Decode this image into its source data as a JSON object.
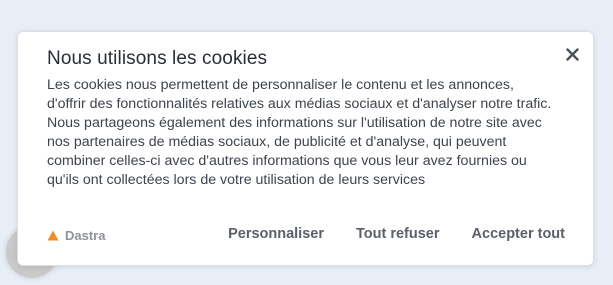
{
  "banner": {
    "title": "Nous utilisons les cookies",
    "body": "Les cookies nous permettent de personnaliser le contenu et les annonces, d'offrir des fonctionnalités relatives aux médias sociaux et d'analyser notre trafic. Nous partageons également des informations sur l'utilisation de notre site avec nos partenaires de médias sociaux, de publicité et d'analyse, qui peuvent combiner celles-ci avec d'autres informations que vous leur avez fournies ou qu'ils ont collectées lors de votre utilisation de leurs services",
    "brand": {
      "name": "Dastra",
      "icon": "triangle-logo-icon",
      "color": "#f28c28"
    },
    "buttons": {
      "customize": "Personnaliser",
      "refuse_all": "Tout refuser",
      "accept_all": "Accepter tout"
    },
    "close_icon": "close-icon"
  }
}
